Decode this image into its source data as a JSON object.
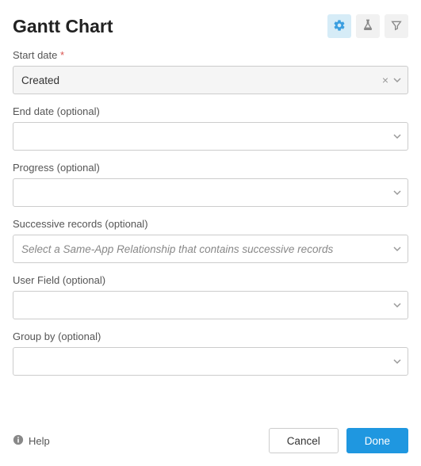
{
  "header": {
    "title": "Gantt Chart",
    "action_settings": "Settings",
    "action_lab": "Lab",
    "action_filter": "Filter"
  },
  "fields": {
    "start_date": {
      "label": "Start date",
      "required": true,
      "value": "Created"
    },
    "end_date": {
      "label": "End date (optional)",
      "value": ""
    },
    "progress": {
      "label": "Progress (optional)",
      "value": ""
    },
    "successive": {
      "label": "Successive records (optional)",
      "value": "",
      "placeholder": "Select a Same-App Relationship that contains successive records"
    },
    "user_field": {
      "label": "User Field (optional)",
      "value": ""
    },
    "group_by": {
      "label": "Group by (optional)",
      "value": ""
    }
  },
  "footer": {
    "help": "Help",
    "cancel": "Cancel",
    "done": "Done"
  },
  "icons": {
    "colors": {
      "active": "#3b9fe0",
      "muted": "#888"
    }
  }
}
